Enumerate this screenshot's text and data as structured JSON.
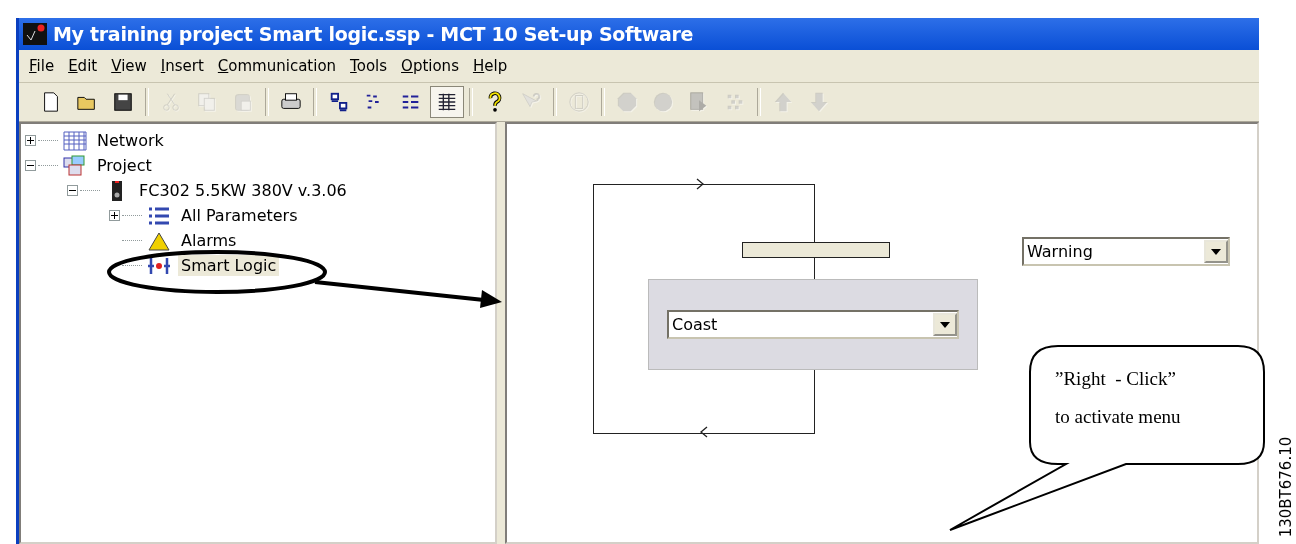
{
  "window": {
    "title": "My training project Smart logic.ssp - MCT 10 Set-up Software"
  },
  "menu": [
    {
      "label": "File"
    },
    {
      "label": "Edit"
    },
    {
      "label": "View"
    },
    {
      "label": "Insert"
    },
    {
      "label": "Communication"
    },
    {
      "label": "Tools"
    },
    {
      "label": "Options"
    },
    {
      "label": "Help"
    }
  ],
  "toolbar": [
    {
      "kind": "new",
      "disabled": false,
      "pressed": false
    },
    {
      "kind": "open",
      "disabled": false,
      "pressed": false
    },
    {
      "kind": "save",
      "disabled": false,
      "pressed": false
    },
    {
      "kind": "separator"
    },
    {
      "kind": "cut",
      "disabled": true,
      "pressed": false
    },
    {
      "kind": "copy",
      "disabled": true,
      "pressed": false
    },
    {
      "kind": "paste",
      "disabled": true,
      "pressed": false
    },
    {
      "kind": "separator"
    },
    {
      "kind": "print",
      "disabled": false,
      "pressed": false
    },
    {
      "kind": "separator"
    },
    {
      "kind": "large-icons",
      "disabled": false,
      "pressed": false
    },
    {
      "kind": "small-icons",
      "disabled": false,
      "pressed": false
    },
    {
      "kind": "list",
      "disabled": false,
      "pressed": false
    },
    {
      "kind": "details",
      "disabled": false,
      "pressed": true
    },
    {
      "kind": "separator"
    },
    {
      "kind": "help",
      "disabled": false,
      "pressed": false
    },
    {
      "kind": "context-help",
      "disabled": true,
      "pressed": false
    },
    {
      "kind": "separator"
    },
    {
      "kind": "device",
      "disabled": true,
      "pressed": false
    },
    {
      "kind": "separator"
    },
    {
      "kind": "stop",
      "disabled": true,
      "pressed": false
    },
    {
      "kind": "record",
      "disabled": true,
      "pressed": false
    },
    {
      "kind": "download",
      "disabled": true,
      "pressed": false
    },
    {
      "kind": "dots",
      "disabled": true,
      "pressed": false
    },
    {
      "kind": "separator"
    },
    {
      "kind": "up",
      "disabled": true,
      "pressed": false
    },
    {
      "kind": "down",
      "disabled": true,
      "pressed": false
    }
  ],
  "tree": [
    {
      "label": "Network",
      "kind": "network",
      "expanded": false,
      "selected": false
    },
    {
      "label": "Project",
      "kind": "project",
      "expanded": true,
      "selected": false,
      "children": [
        {
          "label": "FC302 5.5KW 380V v.3.06",
          "kind": "drive",
          "expanded": true,
          "selected": false,
          "children": [
            {
              "label": "All Parameters",
              "kind": "parameters",
              "expanded": false,
              "selected": false
            },
            {
              "label": "Alarms",
              "kind": "alarms",
              "selected": false
            },
            {
              "label": "Smart Logic",
              "kind": "smart-logic",
              "selected": true
            }
          ]
        }
      ]
    }
  ],
  "smart_logic": {
    "event": {
      "value": "Warning"
    },
    "action": {
      "value": "Coast"
    }
  },
  "callout": {
    "lines": [
      "”Right  - Click”",
      "to activate menu"
    ]
  },
  "figure_code": "130BT676.10"
}
